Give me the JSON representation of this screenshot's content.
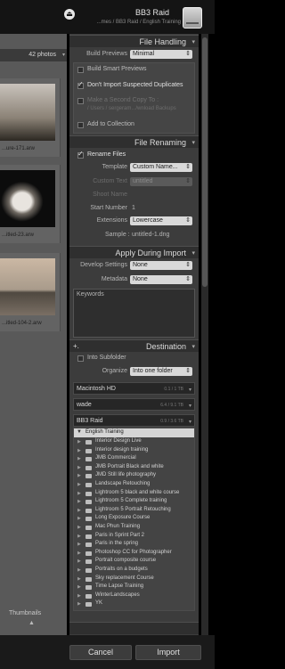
{
  "topbar": {
    "destination_title": "BB3 Raid",
    "destination_path": "...mes / BB3 Raid / English Training",
    "eject_glyph": "⏏"
  },
  "grid": {
    "photo_count": "42 photos",
    "sort_glyph": "▾",
    "thumbnails": [
      {
        "filename": "...ure-171.arw"
      },
      {
        "filename": "...itled-23.arw"
      },
      {
        "filename": "...itled-104-2.arw"
      }
    ],
    "thumbnails_label": "Thumbnails",
    "slider_glyph": "▲"
  },
  "file_handling": {
    "header": "File Handling",
    "collapse_glyph": "▾",
    "build_previews_label": "Build Previews",
    "build_previews_value": "Minimal",
    "smart_previews_label": "Build Smart Previews",
    "no_duplicates_label": "Don't Import Suspected Duplicates",
    "second_copy_label": "Make a Second Copy To :",
    "second_copy_path": "/ Users / sergeram.../wnload Backups",
    "add_collection_label": "Add to Collection"
  },
  "file_renaming": {
    "header": "File Renaming",
    "collapse_glyph": "▾",
    "rename_label": "Rename Files",
    "template_label": "Template",
    "template_value": "Custom Name...",
    "custom_text_label": "Custom Text",
    "custom_text_value": "untitled",
    "shoot_name_label": "Shoot Name",
    "start_number_label": "Start Number",
    "start_number_value": "1",
    "extensions_label": "Extensions",
    "extensions_value": "Lowercase",
    "sample_label": "Sample :",
    "sample_value": "untitled-1.dng"
  },
  "apply_during_import": {
    "header": "Apply During Import",
    "collapse_glyph": "▾",
    "develop_label": "Develop Settings",
    "develop_value": "None",
    "metadata_label": "Metadata",
    "metadata_value": "None",
    "keywords_label": "Keywords"
  },
  "destination": {
    "header": "Destination",
    "plus_glyph": "+.",
    "collapse_glyph": "▾",
    "subfolder_label": "Into Subfolder",
    "organize_label": "Organize",
    "organize_value": "Into one folder",
    "drives": [
      {
        "name": "Macintosh HD",
        "size": "0.1 / 1 TB"
      },
      {
        "name": "wade",
        "size": "6.4 / 9.1 TB"
      },
      {
        "name": "BB3 Raid",
        "size": "0.9 / 3.6 TB"
      }
    ],
    "drive_arrow": "▾",
    "selected_folder": "English Training",
    "folders": [
      "Interior Design Live",
      "Interior design training",
      "JMB Commercial",
      "JMB Portrait Black and white",
      "JMD Still life photography",
      "Landscape Retouching",
      "Lightroom 5 black and white course",
      "Lightroom 5 Complete training",
      "Lightroom 5 Portrait Retouching",
      "Long Exposure Course",
      "Mac Phun Training",
      "Paris in Sprint Part 2",
      "Paris in the spring",
      "Photoshop CC for Photographer",
      "Portrait composite course",
      "Portraits on a budgets",
      "Sky replacement Course",
      "Time Lapse Training",
      "WinterLandscapes",
      "YK"
    ],
    "folder_triangle": "▶"
  },
  "footer": {
    "cancel_label": "Cancel",
    "import_label": "Import"
  },
  "colors": {
    "panel_bg": "#3c3c3c",
    "header_bg": "#2f2f2f",
    "selected_row": "#d5d5d5",
    "dropdown_bg": "#d9d9d9"
  }
}
